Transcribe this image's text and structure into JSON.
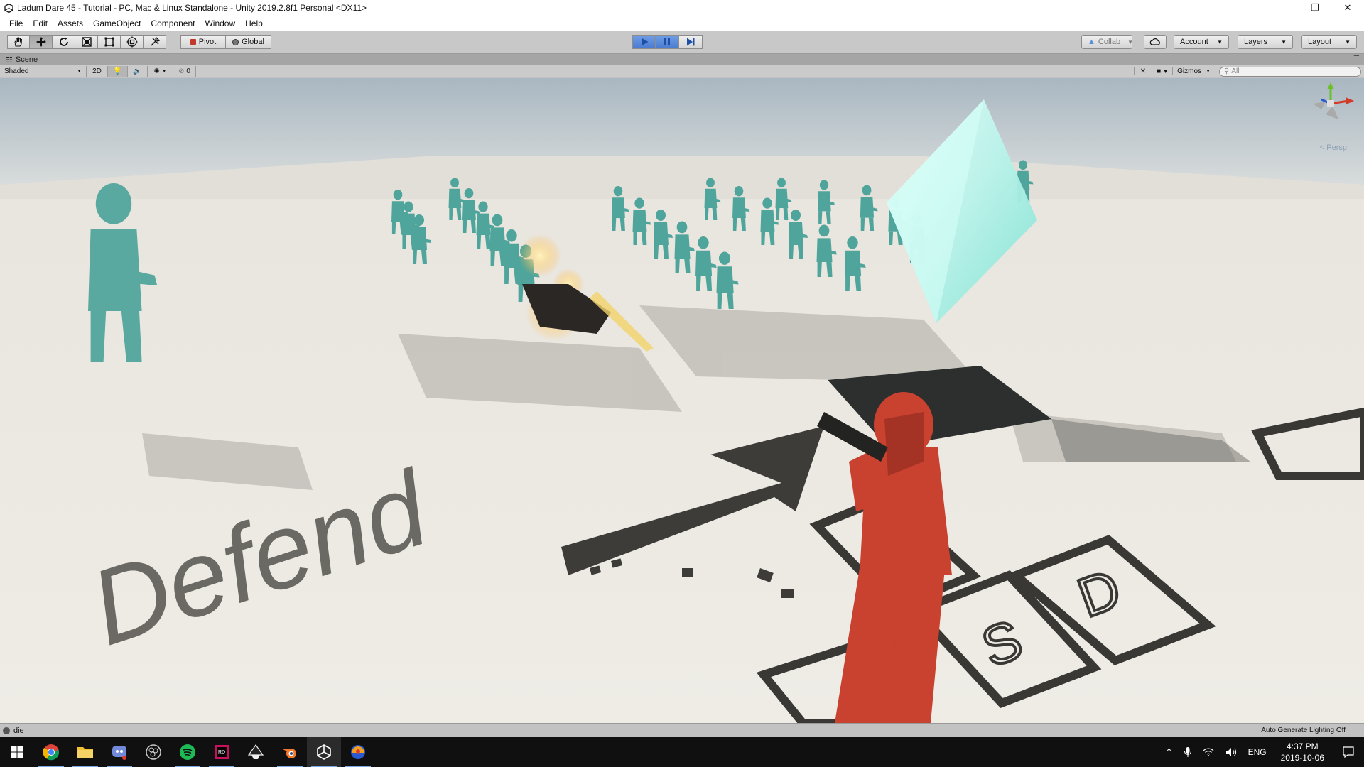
{
  "window": {
    "title": "Ladum Dare 45 - Tutorial - PC, Mac & Linux Standalone - Unity 2019.2.8f1 Personal <DX11>",
    "controls": [
      "minimize-icon",
      "restore-icon",
      "close-icon"
    ]
  },
  "menu": {
    "items": [
      "File",
      "Edit",
      "Assets",
      "GameObject",
      "Component",
      "Window",
      "Help"
    ]
  },
  "toolbar": {
    "tools": [
      "hand-tool-icon",
      "move-tool-icon",
      "rotate-tool-icon",
      "scale-tool-icon",
      "rect-tool-icon",
      "transform-tool-icon",
      "custom-tool-icon"
    ],
    "pivot_label": "Pivot",
    "global_label": "Global",
    "playback": [
      "play-icon",
      "pause-icon",
      "step-icon"
    ],
    "collab_label": "Collab",
    "account_label": "Account",
    "layers_label": "Layers",
    "layout_label": "Layout",
    "accent_color": "#4b7bd0"
  },
  "scene": {
    "tab_label": "Scene",
    "shading_mode": "Shaded",
    "mode_2d": "2D",
    "hidden_count": "0",
    "gizmos_label": "Gizmos",
    "search_placeholder": "All",
    "view_label": "Persp",
    "floor_text": "Defend",
    "key_labels": [
      "S",
      "D"
    ]
  },
  "status": {
    "message": "die",
    "right_text": "Auto Generate Lighting Off"
  },
  "taskbar": {
    "apps": [
      "start-icon",
      "chrome-icon",
      "file-explorer-icon",
      "discord-icon",
      "obs-icon",
      "spotify-icon",
      "rider-icon",
      "inkscape-icon",
      "blender-icon",
      "unity-icon",
      "app-icon"
    ],
    "language": "ENG",
    "time": "4:37 PM",
    "date": "2019-10-06"
  }
}
